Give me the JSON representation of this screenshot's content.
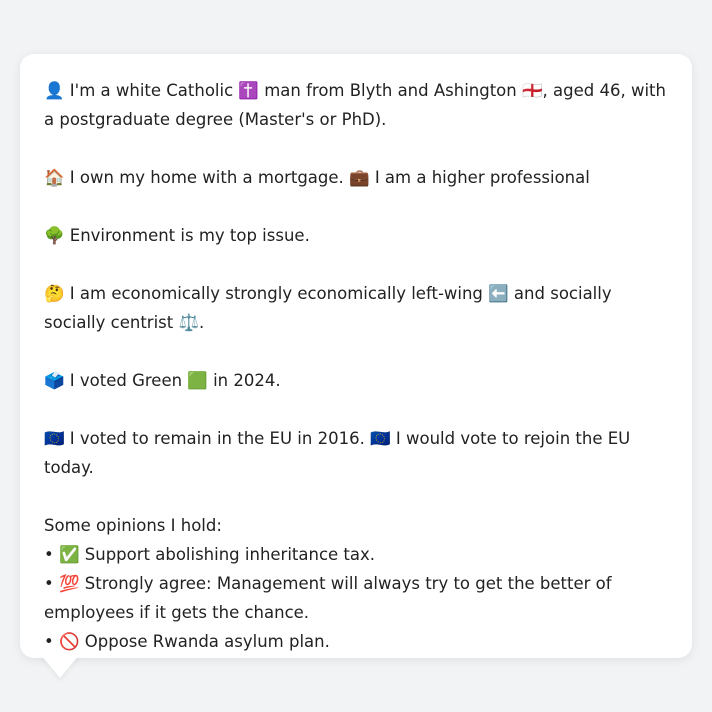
{
  "message": {
    "identity": "👤 I'm a white Catholic ✝️ man from Blyth and Ashington 🏴󠁧󠁢󠁥󠁮󠁧󠁿, aged 46, with a postgraduate degree (Master's or PhD).",
    "home": "🏠 I own my home with a mortgage. 💼 I am a higher professional",
    "issue": "🌳 Environment is my top issue.",
    "politics": "🤔 I am economically strongly economically left-wing ⬅️ and socially socially centrist ⚖️.",
    "vote": "🗳️ I voted Green 🟩 in 2024.",
    "eu": "🇪🇺 I voted to remain in the EU in 2016. 🇪🇺 I would vote to rejoin the EU today.",
    "opinions_header": "Some opinions I hold:",
    "opinions": [
      "• ✅ Support abolishing inheritance tax.",
      "• 💯 Strongly agree: Management will always try to get the better of employees if it gets the chance.",
      "• 🚫 Oppose Rwanda asylum plan."
    ]
  }
}
